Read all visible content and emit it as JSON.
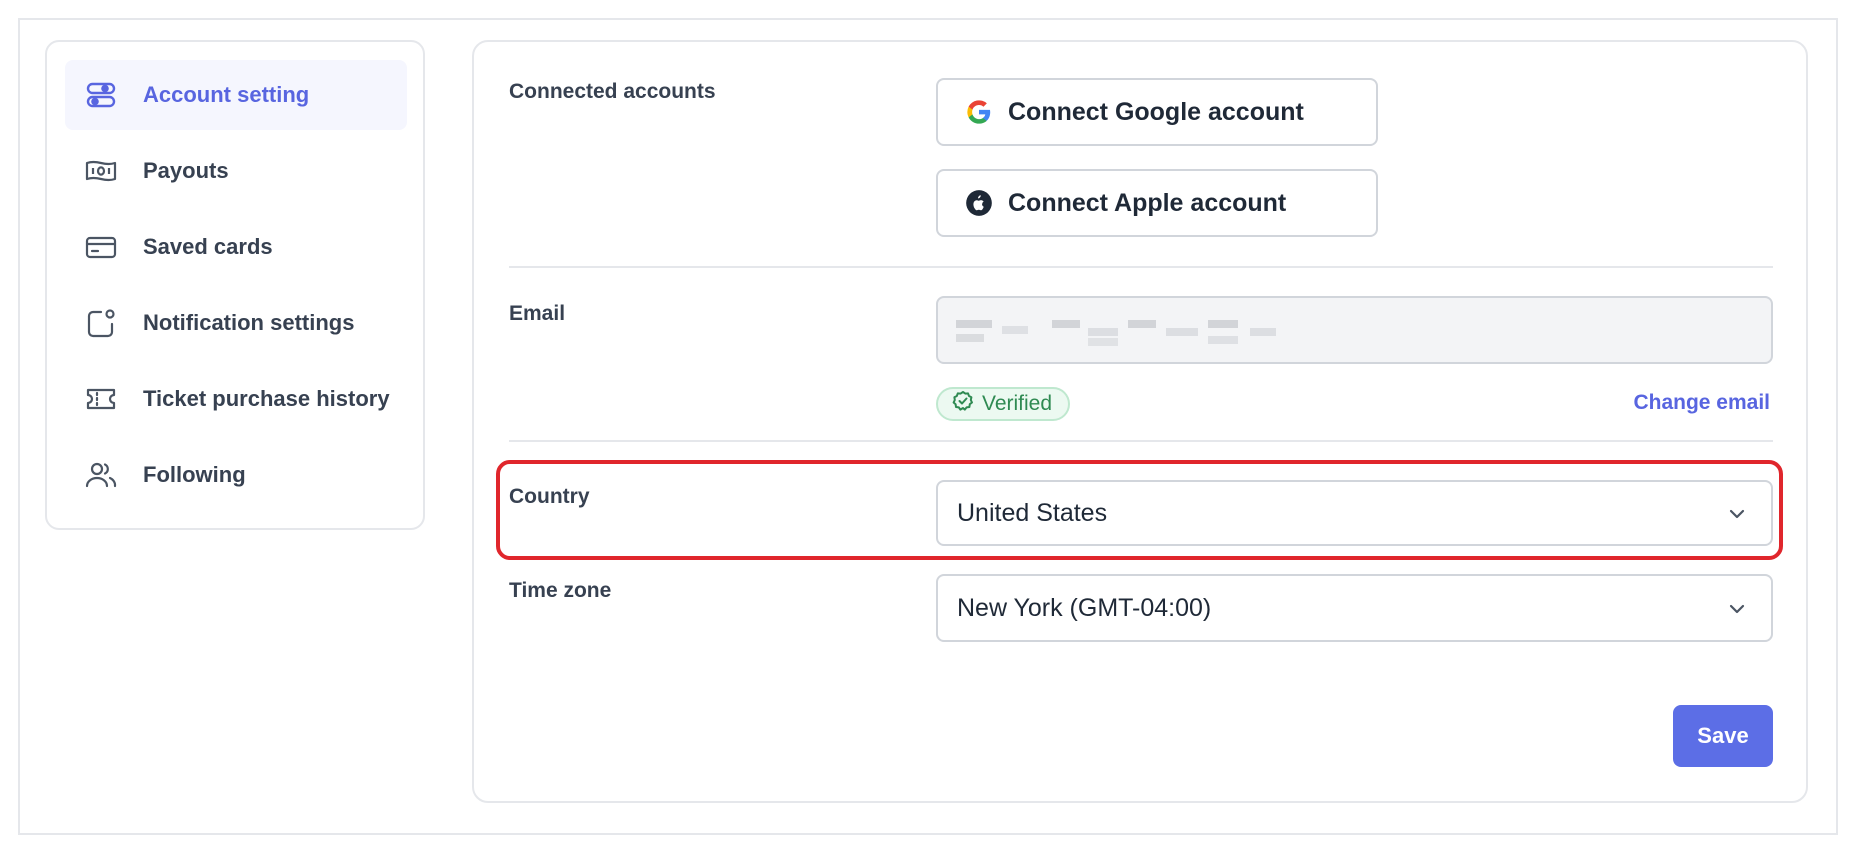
{
  "sidebar": {
    "items": [
      {
        "label": "Account setting",
        "icon": "toggle-settings-icon",
        "active": true
      },
      {
        "label": "Payouts",
        "icon": "cash-icon"
      },
      {
        "label": "Saved cards",
        "icon": "credit-card-icon"
      },
      {
        "label": "Notification settings",
        "icon": "notification-icon"
      },
      {
        "label": "Ticket purchase history",
        "icon": "ticket-icon"
      },
      {
        "label": "Following",
        "icon": "users-icon"
      }
    ]
  },
  "connected": {
    "label": "Connected accounts",
    "google_label": "Connect Google account",
    "apple_label": "Connect Apple account"
  },
  "email": {
    "label": "Email",
    "verified_label": "Verified",
    "change_label": "Change email"
  },
  "country": {
    "label": "Country",
    "value": "United States"
  },
  "timezone": {
    "label": "Time zone",
    "value": "New York (GMT-04:00)"
  },
  "save_label": "Save",
  "colors": {
    "accent": "#5865e0",
    "save": "#5c6ee6",
    "highlight": "#e0262c",
    "verified": "#2f8a52"
  }
}
